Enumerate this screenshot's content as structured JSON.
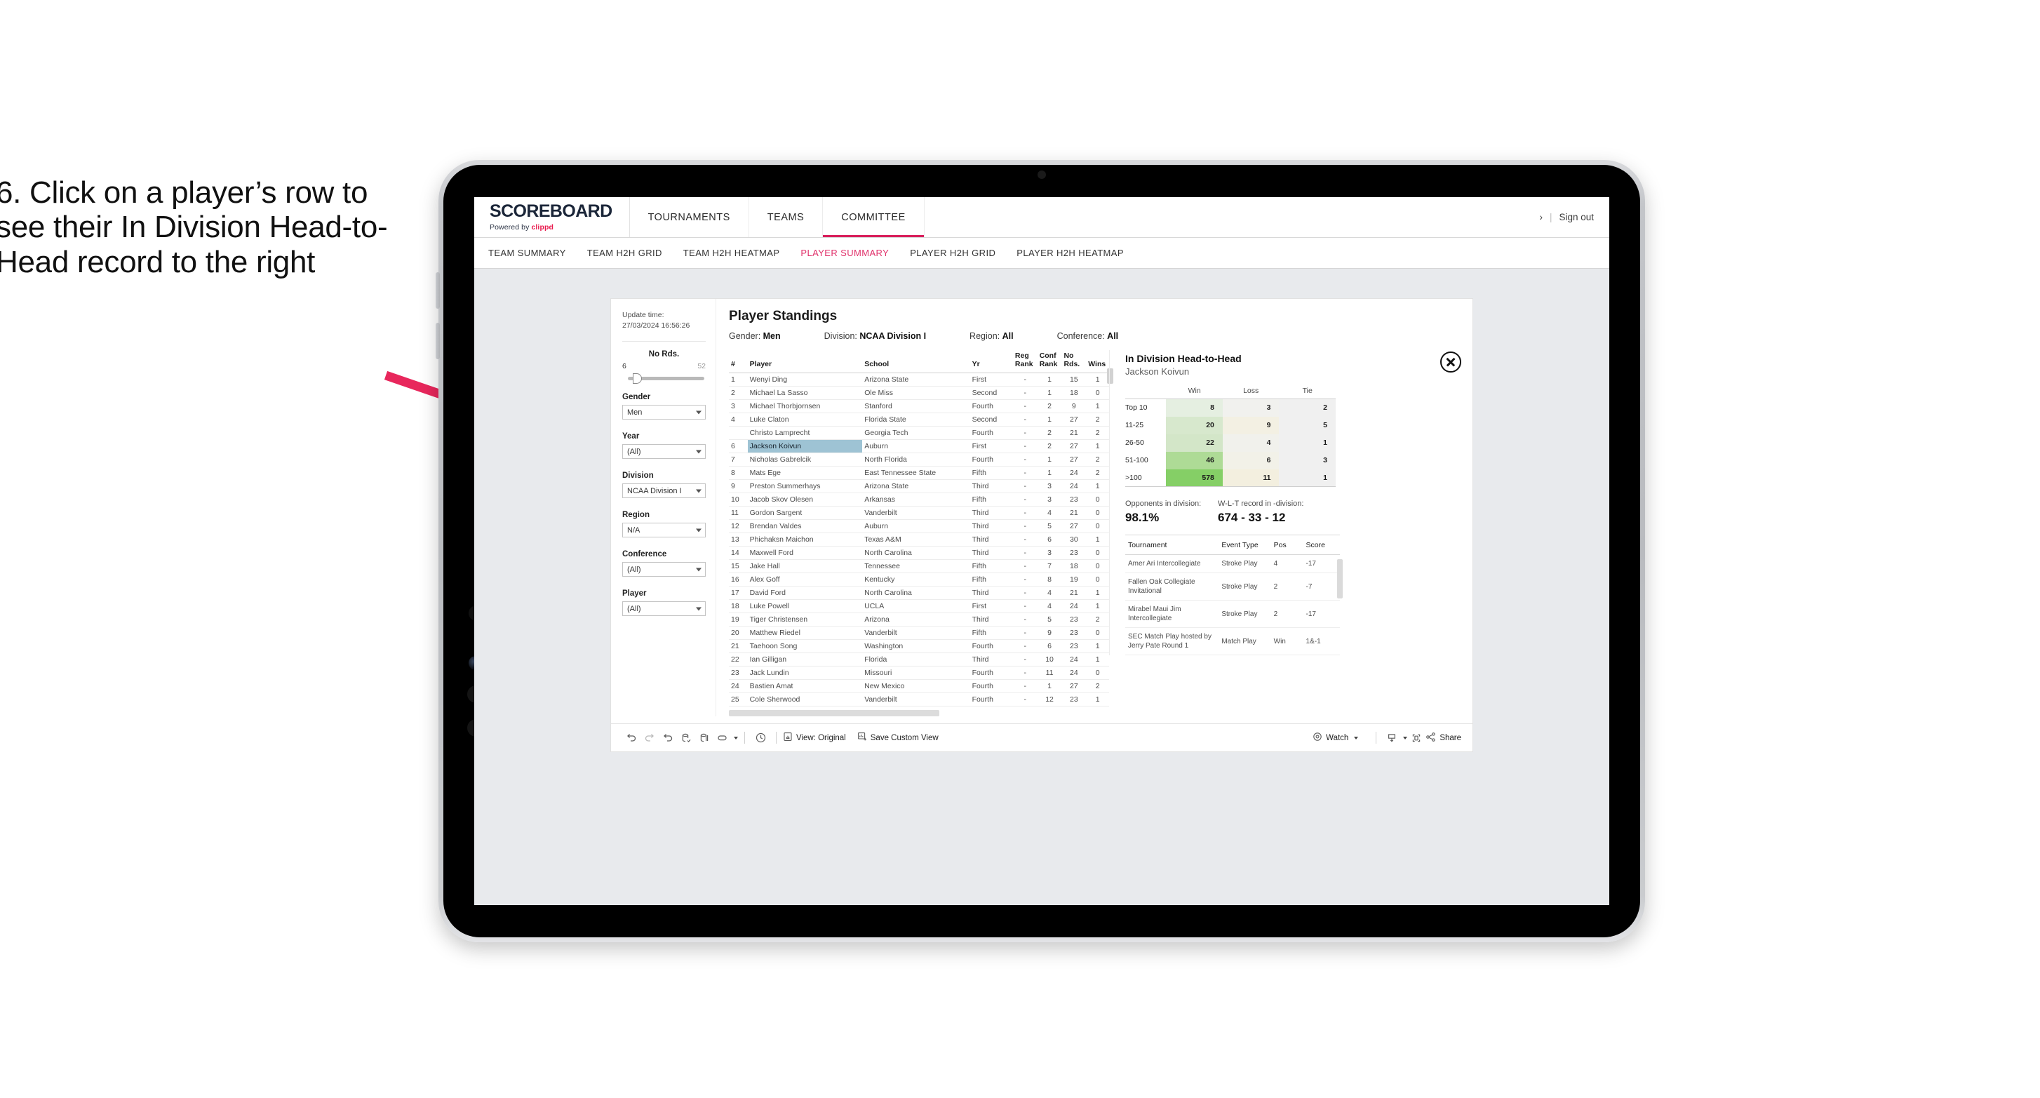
{
  "annotation": {
    "text": "6. Click on a player’s row to see their In Division Head-to-Head record to the right",
    "arrow_color": "#e8275c"
  },
  "header": {
    "logo_main": "SCOREBOARD",
    "logo_sub_prefix": "Powered by ",
    "logo_sub_brand": "clippd",
    "nav": [
      {
        "label": "TOURNAMENTS",
        "active": false
      },
      {
        "label": "TEAMS",
        "active": false
      },
      {
        "label": "COMMITTEE",
        "active": true
      }
    ],
    "user_glyph": "›",
    "separator": "|",
    "sign_out": "Sign out"
  },
  "sub_nav": [
    {
      "label": "TEAM SUMMARY",
      "active": false
    },
    {
      "label": "TEAM H2H GRID",
      "active": false
    },
    {
      "label": "TEAM H2H HEATMAP",
      "active": false
    },
    {
      "label": "PLAYER SUMMARY",
      "active": true
    },
    {
      "label": "PLAYER H2H GRID",
      "active": false
    },
    {
      "label": "PLAYER H2H HEATMAP",
      "active": false
    }
  ],
  "filters": {
    "update_time_label": "Update time:",
    "update_time_value": "27/03/2024 16:56:26",
    "slider": {
      "title": "No Rds.",
      "min": "6",
      "max": "52",
      "position_pct": 6
    },
    "groups": [
      {
        "label": "Gender",
        "value": "Men"
      },
      {
        "label": "Year",
        "value": "(All)"
      },
      {
        "label": "Division",
        "value": "NCAA Division I"
      },
      {
        "label": "Region",
        "value": "N/A"
      },
      {
        "label": "Conference",
        "value": "(All)"
      },
      {
        "label": "Player",
        "value": "(All)"
      }
    ]
  },
  "standings": {
    "title": "Player Standings",
    "summary": [
      {
        "label": "Gender:",
        "value": "Men"
      },
      {
        "label": "Division:",
        "value": "NCAA Division I"
      },
      {
        "label": "Region:",
        "value": "All"
      },
      {
        "label": "Conference:",
        "value": "All"
      }
    ],
    "columns": [
      "#",
      "Player",
      "School",
      "Yr",
      "Reg Rank",
      "Conf Rank",
      "No Rds.",
      "Wins"
    ],
    "rows": [
      {
        "num": "1",
        "player": "Wenyi Ding",
        "school": "Arizona State",
        "yr": "First",
        "reg": "-",
        "conf": "1",
        "rds": "15",
        "wins": "1",
        "selected": false
      },
      {
        "num": "2",
        "player": "Michael La Sasso",
        "school": "Ole Miss",
        "yr": "Second",
        "reg": "-",
        "conf": "1",
        "rds": "18",
        "wins": "0",
        "selected": false
      },
      {
        "num": "3",
        "player": "Michael Thorbjornsen",
        "school": "Stanford",
        "yr": "Fourth",
        "reg": "-",
        "conf": "2",
        "rds": "9",
        "wins": "1",
        "selected": false
      },
      {
        "num": "4",
        "player": "Luke Claton",
        "school": "Florida State",
        "yr": "Second",
        "reg": "-",
        "conf": "1",
        "rds": "27",
        "wins": "2",
        "selected": false
      },
      {
        "num": "",
        "player": "Christo Lamprecht",
        "school": "Georgia Tech",
        "yr": "Fourth",
        "reg": "-",
        "conf": "2",
        "rds": "21",
        "wins": "2",
        "selected": false
      },
      {
        "num": "6",
        "player": "Jackson Koivun",
        "school": "Auburn",
        "yr": "First",
        "reg": "-",
        "conf": "2",
        "rds": "27",
        "wins": "1",
        "selected": true
      },
      {
        "num": "7",
        "player": "Nicholas Gabrelcik",
        "school": "North Florida",
        "yr": "Fourth",
        "reg": "-",
        "conf": "1",
        "rds": "27",
        "wins": "2",
        "selected": false
      },
      {
        "num": "8",
        "player": "Mats Ege",
        "school": "East Tennessee State",
        "yr": "Fifth",
        "reg": "-",
        "conf": "1",
        "rds": "24",
        "wins": "2",
        "selected": false
      },
      {
        "num": "9",
        "player": "Preston Summerhays",
        "school": "Arizona State",
        "yr": "Third",
        "reg": "-",
        "conf": "3",
        "rds": "24",
        "wins": "1",
        "selected": false
      },
      {
        "num": "10",
        "player": "Jacob Skov Olesen",
        "school": "Arkansas",
        "yr": "Fifth",
        "reg": "-",
        "conf": "3",
        "rds": "23",
        "wins": "0",
        "selected": false
      },
      {
        "num": "11",
        "player": "Gordon Sargent",
        "school": "Vanderbilt",
        "yr": "Third",
        "reg": "-",
        "conf": "4",
        "rds": "21",
        "wins": "0",
        "selected": false
      },
      {
        "num": "12",
        "player": "Brendan Valdes",
        "school": "Auburn",
        "yr": "Third",
        "reg": "-",
        "conf": "5",
        "rds": "27",
        "wins": "0",
        "selected": false
      },
      {
        "num": "13",
        "player": "Phichaksn Maichon",
        "school": "Texas A&M",
        "yr": "Third",
        "reg": "-",
        "conf": "6",
        "rds": "30",
        "wins": "1",
        "selected": false
      },
      {
        "num": "14",
        "player": "Maxwell Ford",
        "school": "North Carolina",
        "yr": "Third",
        "reg": "-",
        "conf": "3",
        "rds": "23",
        "wins": "0",
        "selected": false
      },
      {
        "num": "15",
        "player": "Jake Hall",
        "school": "Tennessee",
        "yr": "Fifth",
        "reg": "-",
        "conf": "7",
        "rds": "18",
        "wins": "0",
        "selected": false
      },
      {
        "num": "16",
        "player": "Alex Goff",
        "school": "Kentucky",
        "yr": "Fifth",
        "reg": "-",
        "conf": "8",
        "rds": "19",
        "wins": "0",
        "selected": false
      },
      {
        "num": "17",
        "player": "David Ford",
        "school": "North Carolina",
        "yr": "Third",
        "reg": "-",
        "conf": "4",
        "rds": "21",
        "wins": "1",
        "selected": false
      },
      {
        "num": "18",
        "player": "Luke Powell",
        "school": "UCLA",
        "yr": "First",
        "reg": "-",
        "conf": "4",
        "rds": "24",
        "wins": "1",
        "selected": false
      },
      {
        "num": "19",
        "player": "Tiger Christensen",
        "school": "Arizona",
        "yr": "Third",
        "reg": "-",
        "conf": "5",
        "rds": "23",
        "wins": "2",
        "selected": false
      },
      {
        "num": "20",
        "player": "Matthew Riedel",
        "school": "Vanderbilt",
        "yr": "Fifth",
        "reg": "-",
        "conf": "9",
        "rds": "23",
        "wins": "0",
        "selected": false
      },
      {
        "num": "21",
        "player": "Taehoon Song",
        "school": "Washington",
        "yr": "Fourth",
        "reg": "-",
        "conf": "6",
        "rds": "23",
        "wins": "1",
        "selected": false
      },
      {
        "num": "22",
        "player": "Ian Gilligan",
        "school": "Florida",
        "yr": "Third",
        "reg": "-",
        "conf": "10",
        "rds": "24",
        "wins": "1",
        "selected": false
      },
      {
        "num": "23",
        "player": "Jack Lundin",
        "school": "Missouri",
        "yr": "Fourth",
        "reg": "-",
        "conf": "11",
        "rds": "24",
        "wins": "0",
        "selected": false
      },
      {
        "num": "24",
        "player": "Bastien Amat",
        "school": "New Mexico",
        "yr": "Fourth",
        "reg": "-",
        "conf": "1",
        "rds": "27",
        "wins": "2",
        "selected": false
      },
      {
        "num": "25",
        "player": "Cole Sherwood",
        "school": "Vanderbilt",
        "yr": "Fourth",
        "reg": "-",
        "conf": "12",
        "rds": "23",
        "wins": "1",
        "selected": false
      }
    ]
  },
  "h2h": {
    "title": "In Division Head-to-Head",
    "player": "Jackson Koivun",
    "close_icon": "close-circle-icon",
    "heatmap": {
      "columns": [
        "Win",
        "Loss",
        "Tie"
      ],
      "rows": [
        {
          "label": "Top 10",
          "win": "8",
          "loss": "3",
          "tie": "2",
          "win_color": "#e5efe1",
          "loss_color": "#f1f1ee",
          "tie_color": "#f0f0f0"
        },
        {
          "label": "11-25",
          "win": "20",
          "loss": "9",
          "tie": "5",
          "win_color": "#d7e8cd",
          "loss_color": "#f3f0e3",
          "tie_color": "#f0f0f0"
        },
        {
          "label": "26-50",
          "win": "22",
          "loss": "4",
          "tie": "1",
          "win_color": "#d3e6c8",
          "loss_color": "#f1f1ec",
          "tie_color": "#f0f0f0"
        },
        {
          "label": "51-100",
          "win": "46",
          "loss": "6",
          "tie": "3",
          "win_color": "#aedb96",
          "loss_color": "#f2f1e8",
          "tie_color": "#f0f0f0"
        },
        {
          "label": ">100",
          "win": "578",
          "loss": "11",
          "tie": "1",
          "win_color": "#85cf66",
          "loss_color": "#f3efdf",
          "tie_color": "#f0f0f0"
        }
      ]
    },
    "stats": [
      {
        "label": "Opponents in division:",
        "value": "98.1%"
      },
      {
        "label": "W-L-T record in -division:",
        "value": "674 - 33 - 12"
      }
    ],
    "tournaments": {
      "columns": [
        "Tournament",
        "Event Type",
        "Pos",
        "Score"
      ],
      "rows": [
        {
          "name": "Amer Ari Intercollegiate",
          "type": "Stroke Play",
          "pos": "4",
          "score": "-17"
        },
        {
          "name": "Fallen Oak Collegiate Invitational",
          "type": "Stroke Play",
          "pos": "2",
          "score": "-7"
        },
        {
          "name": "Mirabel Maui Jim Intercollegiate",
          "type": "Stroke Play",
          "pos": "2",
          "score": "-17"
        },
        {
          "name": "SEC Match Play hosted by Jerry Pate Round 1",
          "type": "Match Play",
          "pos": "Win",
          "score": "1&-1"
        }
      ]
    }
  },
  "toolbar": {
    "view_label": "View: Original",
    "save_label": "Save Custom View",
    "watch_label": "Watch",
    "share_label": "Share"
  }
}
